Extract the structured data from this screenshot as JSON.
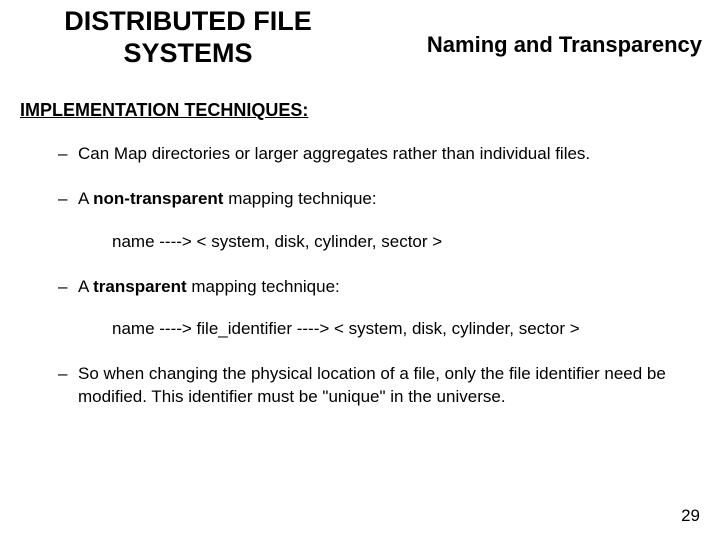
{
  "header": {
    "title_line1": "DISTRIBUTED FILE",
    "title_line2": "SYSTEMS",
    "subtitle": "Naming and Transparency"
  },
  "section_heading": "IMPLEMENTATION TECHNIQUES:",
  "bullets": {
    "b1": "Can Map directories or larger aggregates rather than individual files.",
    "b2_pre": "A  ",
    "b2_bold": "non-transparent",
    "b2_post": "   mapping technique:",
    "b2_sub": "name ----> < system, disk, cylinder, sector >",
    "b3_pre": "A  ",
    "b3_bold": "transparent",
    "b3_post": "   mapping technique:",
    "b3_sub": "name ----> file_identifier ----> < system, disk, cylinder, sector >",
    "b4": "So when changing the physical location of a file, only the file identifier need be modified. This identifier must be \"unique\" in the universe."
  },
  "page_number": "29"
}
